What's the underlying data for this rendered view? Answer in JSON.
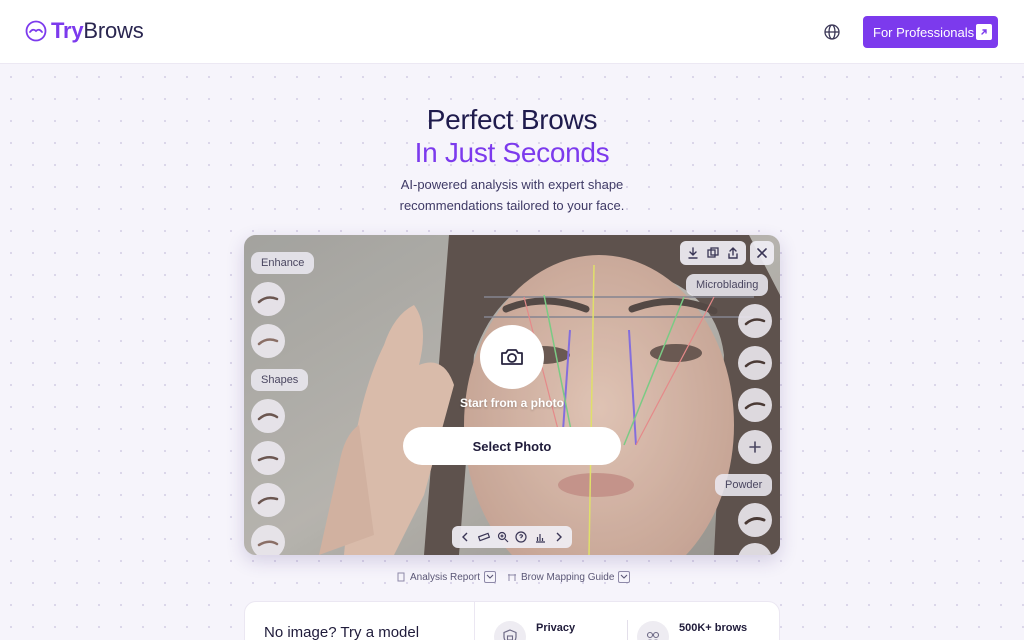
{
  "header": {
    "logo_try": "Try",
    "logo_brows": "Brows",
    "language_icon": "globe-icon",
    "pro_button_label": "For Professionals",
    "pro_button_icon": "external-link-icon"
  },
  "hero": {
    "title_line1": "Perfect Brows",
    "title_line2": "In Just Seconds",
    "subtitle_line1": "AI-powered analysis with expert shape",
    "subtitle_line2": "recommendations tailored to your face."
  },
  "editor": {
    "left_groups": [
      {
        "label": "Enhance"
      },
      {
        "label": "Shapes"
      }
    ],
    "right_groups": [
      {
        "label": "Microblading"
      },
      {
        "label": "Powder"
      }
    ],
    "top_tools": [
      "download-icon",
      "compare-icon",
      "share-icon"
    ],
    "close_icon": "close-icon",
    "start_text": "Start from a photo",
    "select_button": "Select Photo",
    "bottom_tools": [
      "chevron-left-icon",
      "ruler-icon",
      "zoom-icon",
      "help-icon",
      "chart-icon",
      "chevron-right-icon"
    ]
  },
  "links": {
    "analysis_report": "Analysis Report",
    "brow_mapping_guide": "Brow Mapping Guide"
  },
  "bottom_card": {
    "model_prompt": "No image? Try a model",
    "features": [
      {
        "title": "Privacy",
        "icon": "lock-shield-icon"
      },
      {
        "title": "500K+ brows",
        "icon": "users-icon"
      }
    ]
  },
  "colors": {
    "accent": "#7c3aed",
    "title": "#1f1b4d",
    "background": "#f6f4fb"
  }
}
